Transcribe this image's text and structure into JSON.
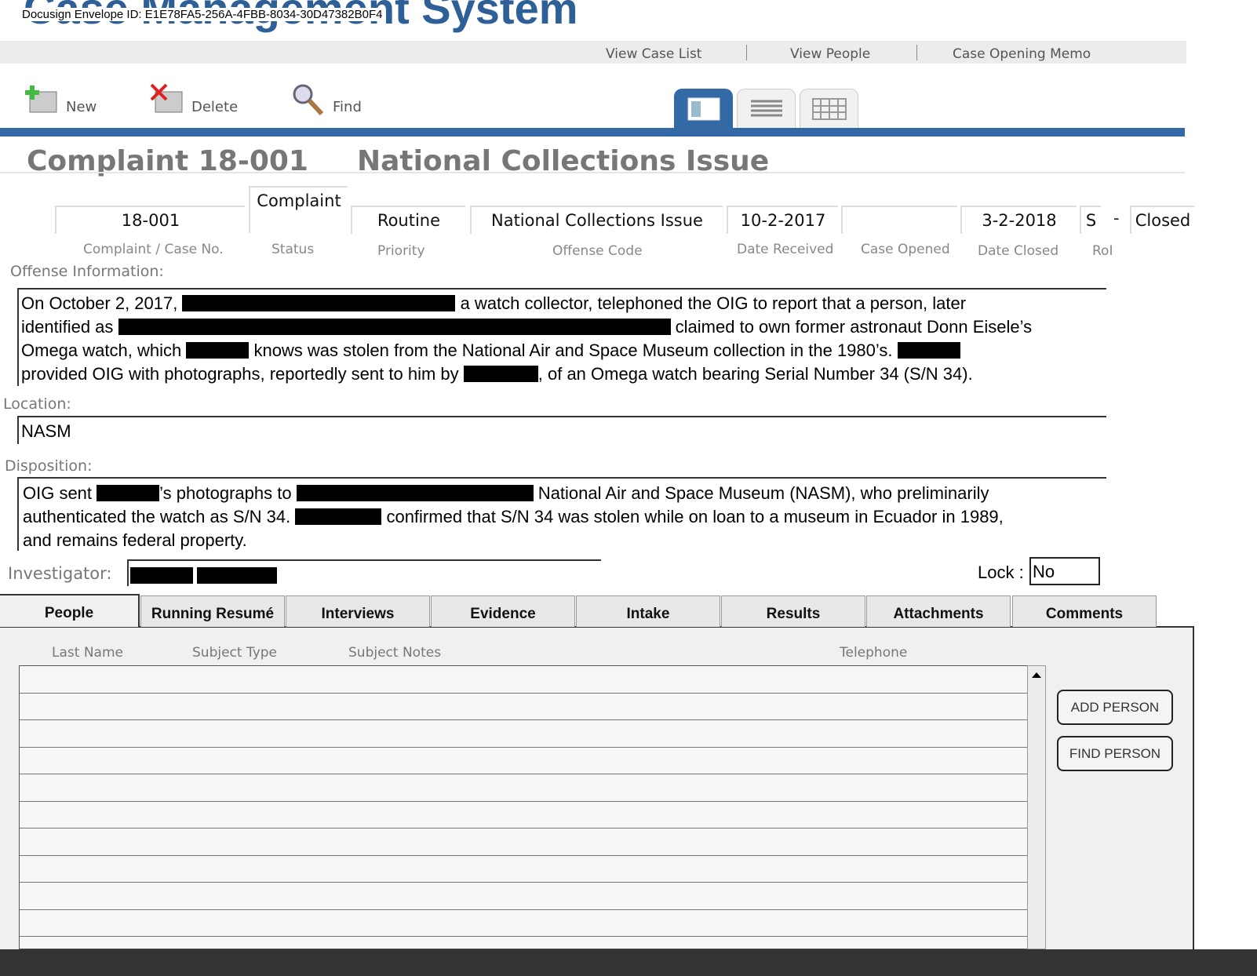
{
  "app": {
    "title": "Case Management System",
    "envelope": "Docusign Envelope ID: E1E78FA5-256A-4FBB-8034-30D47382B0F4"
  },
  "nav": [
    "View Case List",
    "View People",
    "Case Opening Memo"
  ],
  "toolbar": {
    "new": "New",
    "delete": "Delete",
    "find": "Find"
  },
  "heading": {
    "id": "Complaint 18-001",
    "name": "National Collections Issue"
  },
  "fields": {
    "case_no": "18-001",
    "status": "Complaint",
    "priority": "Routine",
    "offense": "National Collections Issue",
    "received": "10-2-2017",
    "opened": "",
    "closed": "3-2-2018",
    "roi_a": "S",
    "roi_b": "-",
    "roi_c": "Closed"
  },
  "labels": {
    "case_no": "Complaint / Case No.",
    "status": "Status",
    "priority": "Priority",
    "offense": "Offense Code",
    "received": "Date Received",
    "opened": "Case Opened",
    "closed": "Date Closed",
    "roi": "RoI",
    "offense_info": "Offense Information:",
    "location": "Location:",
    "disposition": "Disposition:",
    "investigator": "Investigator:",
    "lock": "Lock :"
  },
  "offense_text": [
    "On October 2, 2017,",
    " a watch collector, telephoned the OIG to report that a person, later",
    "identified as",
    " claimed to own former astronaut Donn Eisele’s",
    "Omega watch, which",
    " knows was stolen from the National Air and Space Museum collection in the 1980’s.",
    "provided OIG with photographs, reportedly sent to him by",
    ", of an Omega watch bearing Serial Number 34 (S/N 34)."
  ],
  "location": "NASM",
  "disposition_text": [
    "OIG sent",
    "’s photographs to",
    " National Air and Space Museum (NASM), who preliminarily",
    "authenticated the watch as S/N 34.",
    " confirmed that S/N 34 was stolen while on loan to a museum in Ecuador in 1989,",
    "and remains federal property."
  ],
  "lock": "No",
  "tabs": [
    "People",
    "Running Resumé",
    "Interviews",
    "Evidence",
    "Intake",
    "Results",
    "Attachments",
    "Comments"
  ],
  "people": {
    "columns": [
      "Last Name",
      "Subject Type",
      "Subject Notes",
      "Telephone"
    ],
    "add": "ADD PERSON",
    "find": "FIND PERSON"
  }
}
